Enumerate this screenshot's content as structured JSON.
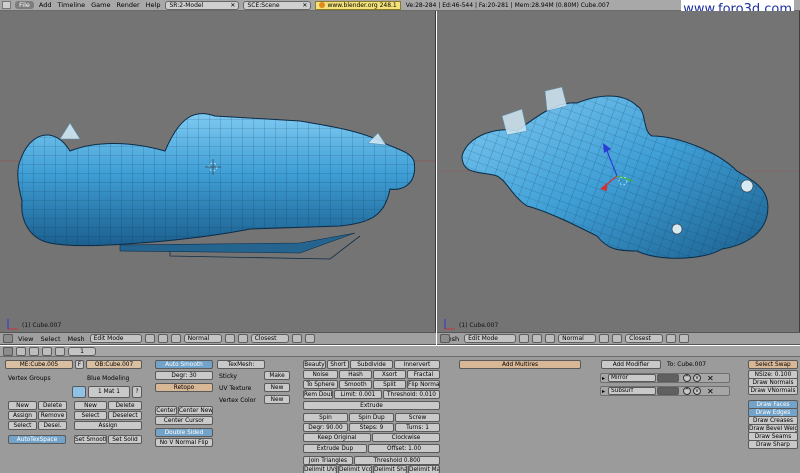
{
  "topbar": {
    "menus": [
      "File",
      "Add",
      "Timeline",
      "Game",
      "Render",
      "Help"
    ],
    "screen": "SR:2-Model",
    "scene": "SCE:Scene",
    "website": "www.blender.org 248.1",
    "stats": "Ve:28-284 | Ed:46-544 | Fa:20-281 | Mem:28.94M (0.80M) Cube.007"
  },
  "watermark": "www.foro3d.com",
  "viewport_left": {
    "object_label": "(1) Cube.007"
  },
  "viewport_right": {
    "object_label": "(1) Cube.007"
  },
  "header_left": {
    "menus": [
      "View",
      "Select",
      "Mesh"
    ],
    "mode": "Edit Mode",
    "shading": "Normal",
    "snap": "Closest"
  },
  "header_right": {
    "menus": [
      "Mesh"
    ],
    "mode": "Edit Mode",
    "shading": "Normal",
    "snap": "Closest"
  },
  "buttons_header": {
    "frame": "1"
  },
  "link_panel": {
    "mesh_name": "ME:Cube.005",
    "f_label": "F",
    "object_name": "OB:Cube.007",
    "vertex_groups": "Vertex Groups",
    "material_name": "Blue Modeling",
    "mat_index": "1 Mat 1",
    "question": "?",
    "new": "New",
    "delete": "Delete",
    "assign": "Assign",
    "remove": "Remove",
    "select": "Select",
    "deselect": "Desel.",
    "mat_new": "New",
    "mat_delete": "Delete",
    "mat_select": "Select",
    "mat_deselect": "Deselect",
    "mat_assign": "Assign",
    "autotex": "AutoTexSpace",
    "set_smooth": "Set Smooth",
    "set_solid": "Set Solid"
  },
  "mesh_panel": {
    "auto_smooth": "Auto Smooth",
    "degr": "Degr: 30",
    "retopo": "Retopo",
    "center": "Center",
    "center_new": "Center New",
    "center_cursor": "Center Cursor",
    "double_sided": "Double Sided",
    "no_v_normal_flip": "No V Normal Flip",
    "texmesh": "TexMesh:",
    "sticky": "Sticky",
    "make": "Make",
    "uv_texture": "UV Texture",
    "uv_new": "New",
    "vertex_color": "Vertex Color",
    "vc_new": "New"
  },
  "mesh_tools": {
    "row1": [
      "Beauty",
      "Short",
      "Subdivide",
      "Innervert"
    ],
    "row2": [
      "Noise",
      "Hash",
      "Xsort",
      "Fractal"
    ],
    "row3": [
      "To Sphere",
      "Smooth",
      "Split",
      "Flip Normal"
    ],
    "rem_doubles": "Rem Doubl",
    "limit": "Limit: 0.001",
    "threshold": "Threshold: 0.010",
    "extrude": "Extrude",
    "spin": "Spin",
    "spin_dup": "Spin Dup",
    "screw": "Screw",
    "degr": "Degr: 90.00",
    "steps": "Steps: 9",
    "turns": "Turns: 1",
    "keep_original": "Keep Original",
    "clockwise": "Clockwise",
    "extrude_dup": "Extrude Dup",
    "offset": "Offset: 1.00",
    "join_triangles": "Join Triangles",
    "join_threshold": "Threshold 0.800",
    "delimit": [
      "Delimit UVs",
      "Delimit Vcol",
      "Delimit Shar",
      "Delimit Mat"
    ]
  },
  "multires": {
    "add_multires": "Add Multires"
  },
  "modifiers": {
    "add_modifier": "Add Modifier",
    "to": "To: Cube.007",
    "items": [
      "Mirror",
      "Subsurf"
    ]
  },
  "mesh_tools_more": {
    "select_swap": "Select Swap",
    "nsize": "NSize: 0.100",
    "draw_normals": "Draw Normals",
    "draw_vnormals": "Draw VNormals",
    "draw_faces": "Draw Faces",
    "draw_edges": "Draw Edges",
    "draw_creases": "Draw Creases",
    "draw_bevel": "Draw Bevel Weig",
    "draw_seams": "Draw Seams",
    "draw_sharp": "Draw Sharp"
  },
  "colors": {
    "viewport_bg": "#747474",
    "mesh_blue": "#3f9fd6",
    "mesh_dark": "#1b5f8e",
    "panel_bg": "#9b9b9b",
    "website_yellow": "#f4e27a",
    "watermark_blue": "#1c2f9c"
  }
}
